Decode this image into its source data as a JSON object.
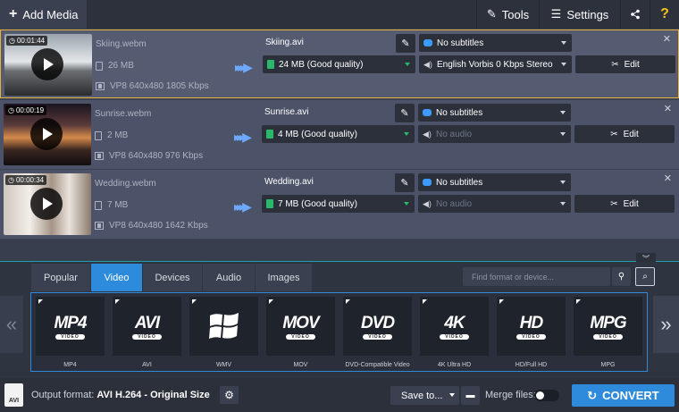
{
  "topbar": {
    "add_media": "Add Media",
    "tools": "Tools",
    "settings": "Settings",
    "help": "?"
  },
  "files": [
    {
      "duration": "00:01:44",
      "source_name": "Skiing.webm",
      "source_size": "26 MB",
      "source_codec": "VP8 640x480 1805 Kbps",
      "output_name": "Skiing.avi",
      "output_quality": "24 MB (Good quality)",
      "subtitles": "No subtitles",
      "audio": "English Vorbis 0 Kbps Stereo",
      "edit": "Edit",
      "selected": true
    },
    {
      "duration": "00:00:19",
      "source_name": "Sunrise.webm",
      "source_size": "2 MB",
      "source_codec": "VP8 640x480 976 Kbps",
      "output_name": "Sunrise.avi",
      "output_quality": "4 MB (Good quality)",
      "subtitles": "No subtitles",
      "audio": "No audio",
      "edit": "Edit",
      "selected": false
    },
    {
      "duration": "00:00:34",
      "source_name": "Wedding.webm",
      "source_size": "7 MB",
      "source_codec": "VP8 640x480 1642 Kbps",
      "output_name": "Wedding.avi",
      "output_quality": "7 MB (Good quality)",
      "subtitles": "No subtitles",
      "audio": "No audio",
      "edit": "Edit",
      "selected": false
    }
  ],
  "format_tabs": [
    "Popular",
    "Video",
    "Devices",
    "Audio",
    "Images"
  ],
  "active_tab": "Video",
  "search": {
    "placeholder": "Find format or device..."
  },
  "formats": [
    {
      "logo": "MP4",
      "sub": "VIDEO",
      "label": "MP4"
    },
    {
      "logo": "AVI",
      "sub": "VIDEO",
      "label": "AVI"
    },
    {
      "logo": "",
      "sub": "",
      "label": "WMV"
    },
    {
      "logo": "MOV",
      "sub": "VIDEO",
      "label": "MOV"
    },
    {
      "logo": "DVD",
      "sub": "VIDEO",
      "label": "DVD-Compatible Video"
    },
    {
      "logo": "4K",
      "sub": "VIDEO",
      "label": "4K Ultra HD"
    },
    {
      "logo": "HD",
      "sub": "VIDEO",
      "label": "HD/Full HD"
    },
    {
      "logo": "MPG",
      "sub": "VIDEO",
      "label": "MPG"
    }
  ],
  "statusbar": {
    "badge": "AVI",
    "output_format_label": "Output format:",
    "output_format_value": "AVI H.264 - Original Size",
    "save_to": "Save to...",
    "merge_files": "Merge files:",
    "convert": "CONVERT"
  },
  "colors": {
    "accent": "#2e8bdb",
    "selection_border": "#e8b13a",
    "good_quality": "#2ab86b"
  }
}
